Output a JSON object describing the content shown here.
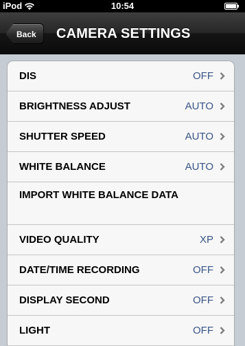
{
  "status_bar": {
    "device": "iPod",
    "time": "10:54"
  },
  "nav": {
    "back_label": "Back",
    "title": "CAMERA SETTINGS"
  },
  "settings": [
    {
      "label": "DIS",
      "value": "OFF",
      "has_chevron": true
    },
    {
      "label": "BRIGHTNESS ADJUST",
      "value": "AUTO",
      "has_chevron": true
    },
    {
      "label": "SHUTTER SPEED",
      "value": "AUTO",
      "has_chevron": true
    },
    {
      "label": "WHITE BALANCE",
      "value": "AUTO",
      "has_chevron": true
    },
    {
      "label": "IMPORT WHITE BALANCE DATA",
      "value": "",
      "has_chevron": false
    },
    {
      "label": "VIDEO QUALITY",
      "value": "XP",
      "has_chevron": true
    },
    {
      "label": "DATE/TIME RECORDING",
      "value": "OFF",
      "has_chevron": true
    },
    {
      "label": "DISPLAY SECOND",
      "value": "OFF",
      "has_chevron": true
    },
    {
      "label": "LIGHT",
      "value": "OFF",
      "has_chevron": true
    }
  ],
  "colors": {
    "background": "#c5ccd4",
    "value_text": "#385487",
    "chevron": "#7f7f7f"
  },
  "icons": {
    "wifi": "wifi-icon",
    "battery": "battery-icon",
    "chevron": "chevron-right-icon"
  }
}
